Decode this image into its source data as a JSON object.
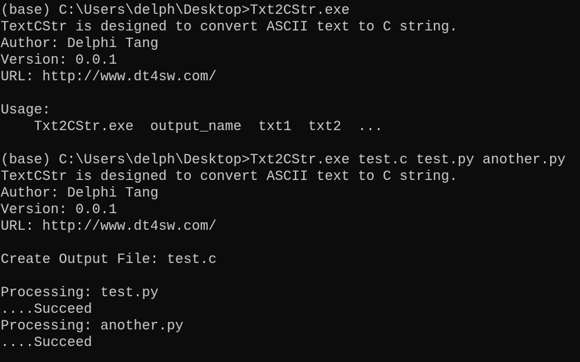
{
  "terminal": {
    "background_color": "#0c0c0c",
    "foreground_color": "#cccccc",
    "prompt_env": "(base)",
    "cwd": "C:\\Users\\delph\\Desktop",
    "program": "Txt2CStr.exe",
    "lines": [
      {
        "id": "prompt-1",
        "text": "(base) C:\\Users\\delph\\Desktop>Txt2CStr.exe"
      },
      {
        "id": "banner-desc-1",
        "text": "TextCStr is designed to convert ASCII text to C string."
      },
      {
        "id": "banner-author-1",
        "text": "Author: Delphi Tang"
      },
      {
        "id": "banner-version-1",
        "text": "Version: 0.0.1"
      },
      {
        "id": "banner-url-1",
        "text": "URL: http://www.dt4sw.com/"
      },
      {
        "id": "blank-1",
        "text": ""
      },
      {
        "id": "usage-heading",
        "text": "Usage:"
      },
      {
        "id": "usage-syntax",
        "text": "    Txt2CStr.exe  output_name  txt1  txt2  ..."
      },
      {
        "id": "blank-2",
        "text": ""
      },
      {
        "id": "prompt-2",
        "text": "(base) C:\\Users\\delph\\Desktop>Txt2CStr.exe test.c test.py another.py"
      },
      {
        "id": "banner-desc-2",
        "text": "TextCStr is designed to convert ASCII text to C string."
      },
      {
        "id": "banner-author-2",
        "text": "Author: Delphi Tang"
      },
      {
        "id": "banner-version-2",
        "text": "Version: 0.0.1"
      },
      {
        "id": "banner-url-2",
        "text": "URL: http://www.dt4sw.com/"
      },
      {
        "id": "blank-3",
        "text": ""
      },
      {
        "id": "create-output",
        "text": "Create Output File: test.c"
      },
      {
        "id": "blank-4",
        "text": ""
      },
      {
        "id": "processing-1",
        "text": "Processing: test.py"
      },
      {
        "id": "result-1",
        "text": "....Succeed"
      },
      {
        "id": "processing-2",
        "text": "Processing: another.py"
      },
      {
        "id": "result-2",
        "text": "....Succeed"
      }
    ]
  }
}
